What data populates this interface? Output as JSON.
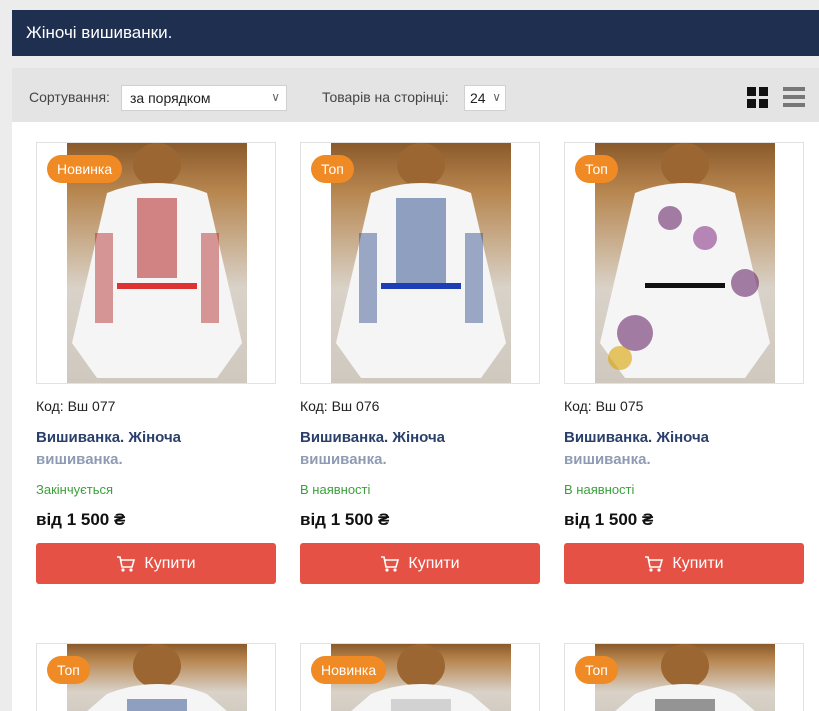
{
  "page": {
    "title": "Жіночі вишиванки."
  },
  "toolbar": {
    "sort_label": "Сортування:",
    "sort_value": "за порядком",
    "perpage_label": "Товарів на сторінці:",
    "perpage_value": "24"
  },
  "products": [
    {
      "badge": "Новинка",
      "code": "Код: Вш 077",
      "name1": "Вишиванка. Жіноча",
      "name2": "вишиванка.",
      "stock": "Закінчується",
      "price": "від 1 500 ₴",
      "buy": "Купити",
      "embroidery_color": "#b22222"
    },
    {
      "badge": "Топ",
      "code": "Код: Вш 076",
      "name1": "Вишиванка. Жіноча",
      "name2": "вишиванка.",
      "stock": "В наявності",
      "price": "від 1 500 ₴",
      "buy": "Купити",
      "embroidery_color": "#2a4a8a"
    },
    {
      "badge": "Топ",
      "code": "Код: Вш 075",
      "name1": "Вишиванка. Жіноча",
      "name2": "вишиванка.",
      "stock": "В наявності",
      "price": "від 1 500 ₴",
      "buy": "Купити",
      "embroidery_color": "#6a2a6a"
    }
  ],
  "products_row2": [
    {
      "badge": "Топ"
    },
    {
      "badge": "Новинка"
    },
    {
      "badge": "Топ"
    }
  ],
  "colors": {
    "header_bg": "#1e2f50",
    "badge": "#ef8a25",
    "buy_button": "#e55245",
    "product_name": "#2a3f6a",
    "in_stock": "#3aa13a"
  },
  "icons": [
    "grid-view-icon",
    "list-view-icon",
    "cart-icon",
    "chevron-down-icon"
  ]
}
